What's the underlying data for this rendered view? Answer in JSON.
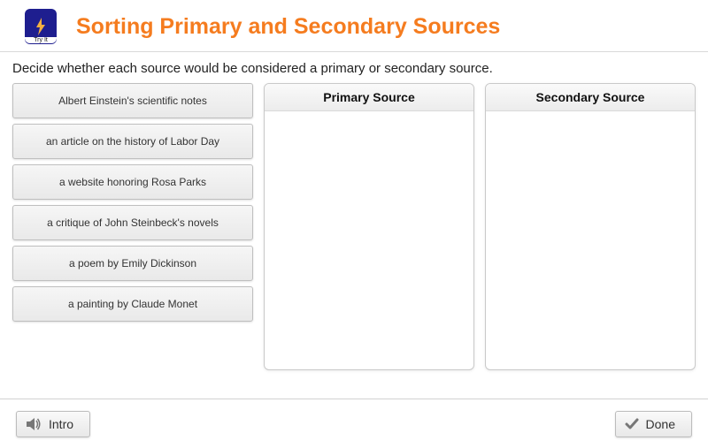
{
  "header": {
    "tryit_label": "Try It",
    "title": "Sorting Primary and Secondary Sources"
  },
  "instructions": "Decide whether each source would be considered a primary or secondary source.",
  "sources": [
    "Albert Einstein's scientific notes",
    "an article on the history of Labor Day",
    "a website honoring Rosa Parks",
    "a critique of John Steinbeck's novels",
    "a poem by Emily Dickinson",
    "a painting by Claude Monet"
  ],
  "drop_zones": {
    "primary": {
      "label": "Primary Source"
    },
    "secondary": {
      "label": "Secondary Source"
    }
  },
  "footer": {
    "intro_label": "Intro",
    "done_label": "Done"
  },
  "icons": {
    "tryit": "bolt-icon",
    "intro": "speaker-icon",
    "done": "check-icon"
  }
}
